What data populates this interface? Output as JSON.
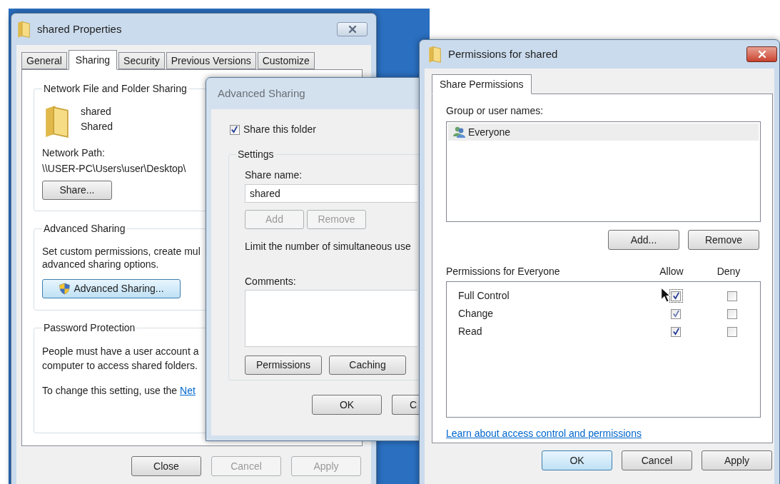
{
  "properties_window": {
    "title": "shared Properties",
    "tabs": [
      {
        "label": "General",
        "selected": false
      },
      {
        "label": "Sharing",
        "selected": true
      },
      {
        "label": "Security",
        "selected": false
      },
      {
        "label": "Previous Versions",
        "selected": false
      },
      {
        "label": "Customize",
        "selected": false
      }
    ],
    "network_sharing": {
      "legend": "Network File and Folder Sharing",
      "folder_name": "shared",
      "folder_status": "Shared",
      "path_label": "Network Path:",
      "path": "\\\\USER-PC\\Users\\user\\Desktop\\",
      "button": "Share..."
    },
    "advanced_sharing": {
      "legend": "Advanced Sharing",
      "description": [
        "Set custom permissions, create mul",
        "advanced sharing options."
      ],
      "button": {
        "label": "Advanced Sharing...",
        "highlighted": true
      }
    },
    "password_protection": {
      "legend": "Password Protection",
      "description": [
        "People must have a user account a",
        "computer to access shared folders."
      ],
      "change_text": "To change this setting, use the",
      "link": "Net"
    },
    "buttons": [
      {
        "label": "Close",
        "disabled": false
      },
      {
        "label": "Cancel",
        "disabled": true
      },
      {
        "label": "Apply",
        "disabled": true
      }
    ]
  },
  "advanced_sharing_window": {
    "title": "Advanced Sharing",
    "share_checkbox": {
      "label": "Share this folder",
      "checked": true
    },
    "settings": {
      "legend": "Settings",
      "share_name_label": "Share name:",
      "share_name": "shared",
      "name_buttons": [
        {
          "label": "Add",
          "disabled": true
        },
        {
          "label": "Remove",
          "disabled": true
        }
      ],
      "limit_text": "Limit the number of simultaneous use",
      "comments_label": "Comments:",
      "buttons": [
        {
          "label": "Permissions",
          "disabled": false
        },
        {
          "label": "Caching",
          "disabled": false
        }
      ]
    },
    "buttons": [
      {
        "label": "OK",
        "disabled": false
      },
      {
        "label": "C",
        "disabled": false
      }
    ]
  },
  "permissions_window": {
    "title": "Permissions for shared",
    "tabs": [
      {
        "label": "Share Permissions",
        "selected": true
      }
    ],
    "group_label": "Group or user names:",
    "users": [
      {
        "name": "Everyone",
        "selected": true
      }
    ],
    "user_buttons": [
      {
        "label": "Add...",
        "disabled": false
      },
      {
        "label": "Remove",
        "disabled": false
      }
    ],
    "permissions_label": "Permissions for Everyone",
    "allow_header": "Allow",
    "deny_header": "Deny",
    "permissions": [
      {
        "name": "Full Control",
        "allow": true,
        "deny": false,
        "focused": true
      },
      {
        "name": "Change",
        "allow": true,
        "deny": false,
        "focused": false
      },
      {
        "name": "Read",
        "allow": true,
        "deny": false,
        "focused": false
      }
    ],
    "link": "Learn about access control and permissions",
    "buttons": [
      {
        "label": "OK",
        "default": true
      },
      {
        "label": "Cancel",
        "default": false
      },
      {
        "label": "Apply",
        "default": false
      }
    ]
  }
}
